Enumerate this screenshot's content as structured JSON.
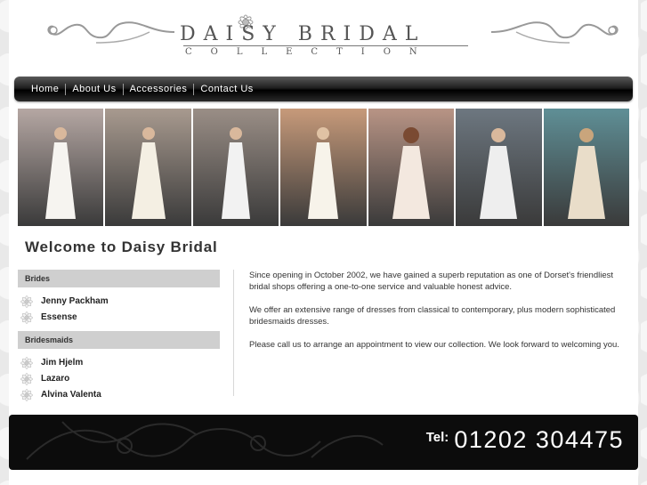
{
  "logo": {
    "title": "DAISY BRIDAL",
    "subtitle": "COLLECTION"
  },
  "nav": {
    "items": [
      "Home",
      "About Us",
      "Accessories",
      "Contact Us"
    ]
  },
  "photos": {
    "colors": [
      "#b5a7a3",
      "#a89a8f",
      "#9a8e86",
      "#c79a7a",
      "#b89485",
      "#6d7780",
      "#5f8f96"
    ]
  },
  "welcome": "Welcome to Daisy Bridal",
  "sidebar": {
    "brides_heading": "Brides",
    "brides": [
      "Jenny Packham",
      "Essense"
    ],
    "bridesmaids_heading": "Bridesmaids",
    "bridesmaids": [
      "Jim Hjelm",
      "Lazaro",
      "Alvina Valenta"
    ]
  },
  "content": {
    "paragraphs": [
      "Since opening in October 2002, we have gained a superb reputation as one of Dorset's friendliest bridal shops offering a one-to-one service and valuable honest advice.",
      "We offer an extensive range of dresses from classical to contemporary, plus modern sophisticated bridesmaids dresses.",
      "Please call us to arrange an appointment to view our collection. We look forward to welcoming you."
    ]
  },
  "footer": {
    "tel_label": "Tel:",
    "tel_number": "01202 304475"
  }
}
